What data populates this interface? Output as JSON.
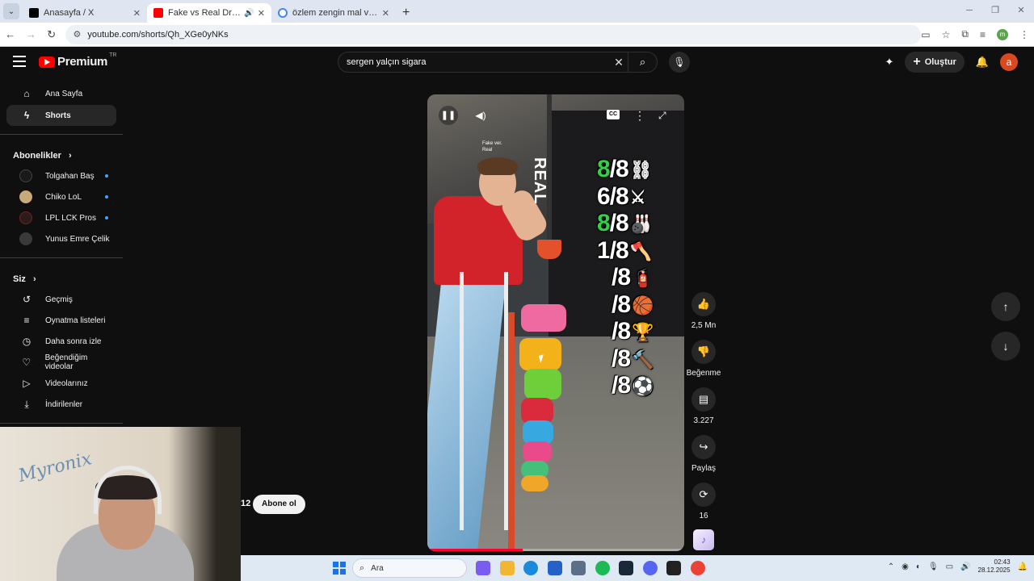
{
  "browser": {
    "tabs": [
      {
        "title": "Anasayfa / X",
        "favicon_color": "#000000",
        "active": false
      },
      {
        "title": "Fake vs Real Drops! - YouTube",
        "favicon_color": "#ff0000",
        "active": true
      },
      {
        "title": "özlem zengin mal varlığı - Google",
        "favicon_color": "#4285f4",
        "active": false
      }
    ],
    "url": "youtube.com/shorts/Qh_XGe0yNKs",
    "profile_initial": "m"
  },
  "youtube": {
    "logo_text": "Premium",
    "logo_country": "TR",
    "search_value": "sergen yalçın sigara",
    "create_label": "Oluştur",
    "avatar_initial": "a"
  },
  "sidebar": {
    "primary": [
      {
        "label": "Ana Sayfa",
        "icon": "home-icon",
        "glyph": "⌂",
        "active": false
      },
      {
        "label": "Shorts",
        "icon": "shorts-icon",
        "glyph": "▶",
        "active": true
      }
    ],
    "subscriptions_title": "Abonelikler",
    "subscriptions": [
      {
        "label": "Tolgahan Baş",
        "color": "#1a1a1a"
      },
      {
        "label": "Chiko LoL",
        "color": "#c8a97a"
      },
      {
        "label": "LPL LCK Pros",
        "color": "#2b1b1b"
      },
      {
        "label": "Yunus Emre Çelik",
        "color": "#3a3a3a"
      }
    ],
    "you_title": "Siz",
    "you_items": [
      {
        "label": "Geçmiş",
        "icon": "history-icon",
        "glyph": "↺"
      },
      {
        "label": "Oynatma listeleri",
        "icon": "playlist-icon",
        "glyph": "≡"
      },
      {
        "label": "Daha sonra izle",
        "icon": "watch-later-icon",
        "glyph": "◷"
      },
      {
        "label": "Beğendiğim videolar",
        "icon": "liked-videos-icon",
        "glyph": "👍"
      },
      {
        "label": "Videolarınız",
        "icon": "your-videos-icon",
        "glyph": "▷"
      },
      {
        "label": "İndirilenler",
        "icon": "downloads-icon",
        "glyph": "⤓"
      }
    ]
  },
  "video": {
    "real_label": "REAL",
    "caption_small": "Fake ver.\nReal",
    "progress": 0.37,
    "scores": [
      {
        "num": "8",
        "den": "/8",
        "green": true,
        "emoji": "⛓"
      },
      {
        "num": "6",
        "den": "/8",
        "green": false,
        "emoji": "⚔"
      },
      {
        "num": "8",
        "den": "/8",
        "green": true,
        "emoji": "🎳"
      },
      {
        "num": "1",
        "den": "/8",
        "green": false,
        "emoji": "🪓"
      },
      {
        "num": "",
        "den": "/8",
        "green": false,
        "emoji": "🧯"
      },
      {
        "num": "",
        "den": "/8",
        "green": false,
        "emoji": "🏀"
      },
      {
        "num": "",
        "den": "/8",
        "green": false,
        "emoji": "🏆"
      },
      {
        "num": "",
        "den": "/8",
        "green": false,
        "emoji": "🔨"
      },
      {
        "num": "",
        "den": "/8",
        "green": false,
        "emoji": "⚽"
      }
    ]
  },
  "actions": {
    "like_count": "2,5 Mn",
    "dislike_label": "Beğenme",
    "comment_count": "3.227",
    "share_label": "Paylaş",
    "remix_count": "16"
  },
  "channel_overlay": {
    "count_fragment": "12",
    "subscribe_label": "Abone ol"
  },
  "webcam": {
    "signature": "Myronix"
  },
  "taskbar": {
    "search_placeholder": "Ara",
    "time": "02:43",
    "date": "28.12.2025",
    "apps": [
      {
        "name": "copilot-icon",
        "color": "#7a5cf0"
      },
      {
        "name": "file-explorer-icon",
        "color": "#f2b632"
      },
      {
        "name": "edge-icon",
        "color": "#1c8adb"
      },
      {
        "name": "store-icon",
        "color": "#2462c9"
      },
      {
        "name": "settings-icon",
        "color": "#5b6f86"
      },
      {
        "name": "spotify-icon",
        "color": "#1db954"
      },
      {
        "name": "steam-icon",
        "color": "#1b2838"
      },
      {
        "name": "discord-icon",
        "color": "#5865f2"
      },
      {
        "name": "app-icon",
        "color": "#222222"
      },
      {
        "name": "chrome-icon",
        "color": "#ea4335"
      }
    ]
  }
}
